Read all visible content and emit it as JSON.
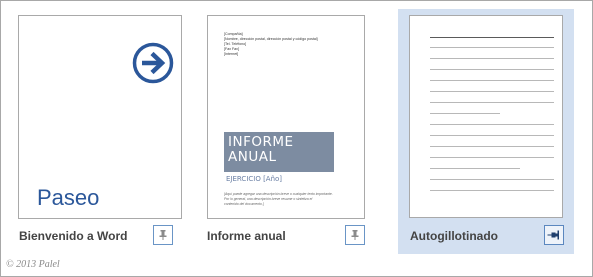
{
  "templates": [
    {
      "label": "Bienvenido a Word",
      "thumbnail_title": "Paseo",
      "thumbnail_icon": "arrow-circle-right-icon",
      "pin_icon": "pin-icon",
      "selected": false
    },
    {
      "label": "Informe anual",
      "thumbnail_header_lines": [
        "[Compañía]",
        "[Nombre, dirección postal, dirección postal y código postal]",
        "[Tel. Teléfono]",
        "[Fax Fax]",
        "[Internet]"
      ],
      "thumbnail_title_lines": [
        "INFORME",
        "ANUAL"
      ],
      "thumbnail_subtitle": "EJERCICIO [Año]",
      "thumbnail_body_lines": [
        "[Aquí puede agregar una descripción breve o cualquier texto importante.",
        "Por lo general, una descripción breve resume o sintetiza el",
        "contenido del documento.]"
      ],
      "pin_icon": "pin-icon",
      "selected": false
    },
    {
      "label": "Autogillotinado",
      "thumbnail_type": "ruled-lines",
      "pin_icon": "pinned-icon",
      "selected": true
    }
  ],
  "footer": {
    "copyright": "© 2013 Palel"
  },
  "colors": {
    "accent_blue": "#2b579a",
    "selected_tile_bg": "#d3e0f1",
    "pin_border": "#6a95c6",
    "cover_band": "#7d8ca1"
  }
}
